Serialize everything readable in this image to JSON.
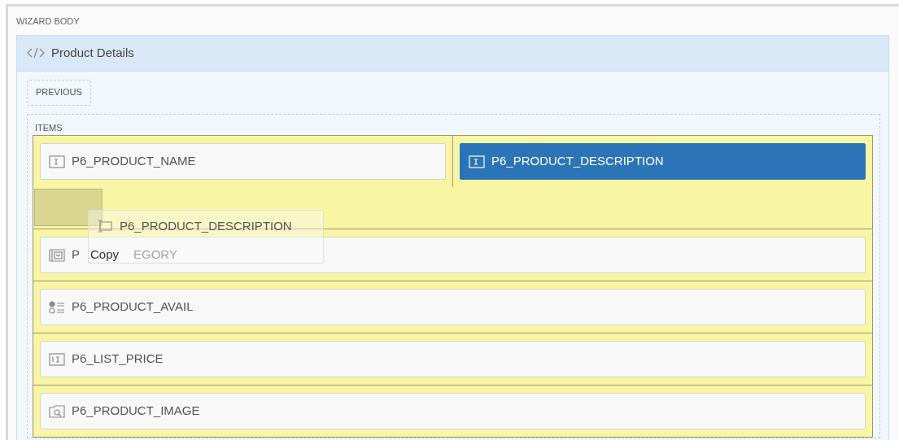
{
  "region_label": "WIZARD BODY",
  "panel": {
    "title": "Product Details"
  },
  "previous_button": "PREVIOUS",
  "items_label": "ITEMS",
  "rows": [
    {
      "kind": "items",
      "items": [
        {
          "kind": "text",
          "label": "P6_PRODUCT_NAME",
          "selected": false
        },
        {
          "kind": "text",
          "label": "P6_PRODUCT_DESCRIPTION",
          "selected": true
        }
      ]
    },
    {
      "kind": "drop"
    },
    {
      "kind": "items",
      "items": [
        {
          "kind": "select",
          "label": "P",
          "label_tail": "EGORY",
          "selected": false
        }
      ]
    },
    {
      "kind": "items",
      "items": [
        {
          "kind": "radio",
          "label": "P6_PRODUCT_AVAIL",
          "selected": false
        }
      ]
    },
    {
      "kind": "items",
      "items": [
        {
          "kind": "number",
          "label": "P6_LIST_PRICE",
          "selected": false
        }
      ]
    },
    {
      "kind": "items",
      "items": [
        {
          "kind": "image",
          "label": "P6_PRODUCT_IMAGE",
          "selected": false
        }
      ]
    }
  ],
  "drag_ghost": {
    "label": "P6_PRODUCT_DESCRIPTION",
    "action": "Copy"
  }
}
